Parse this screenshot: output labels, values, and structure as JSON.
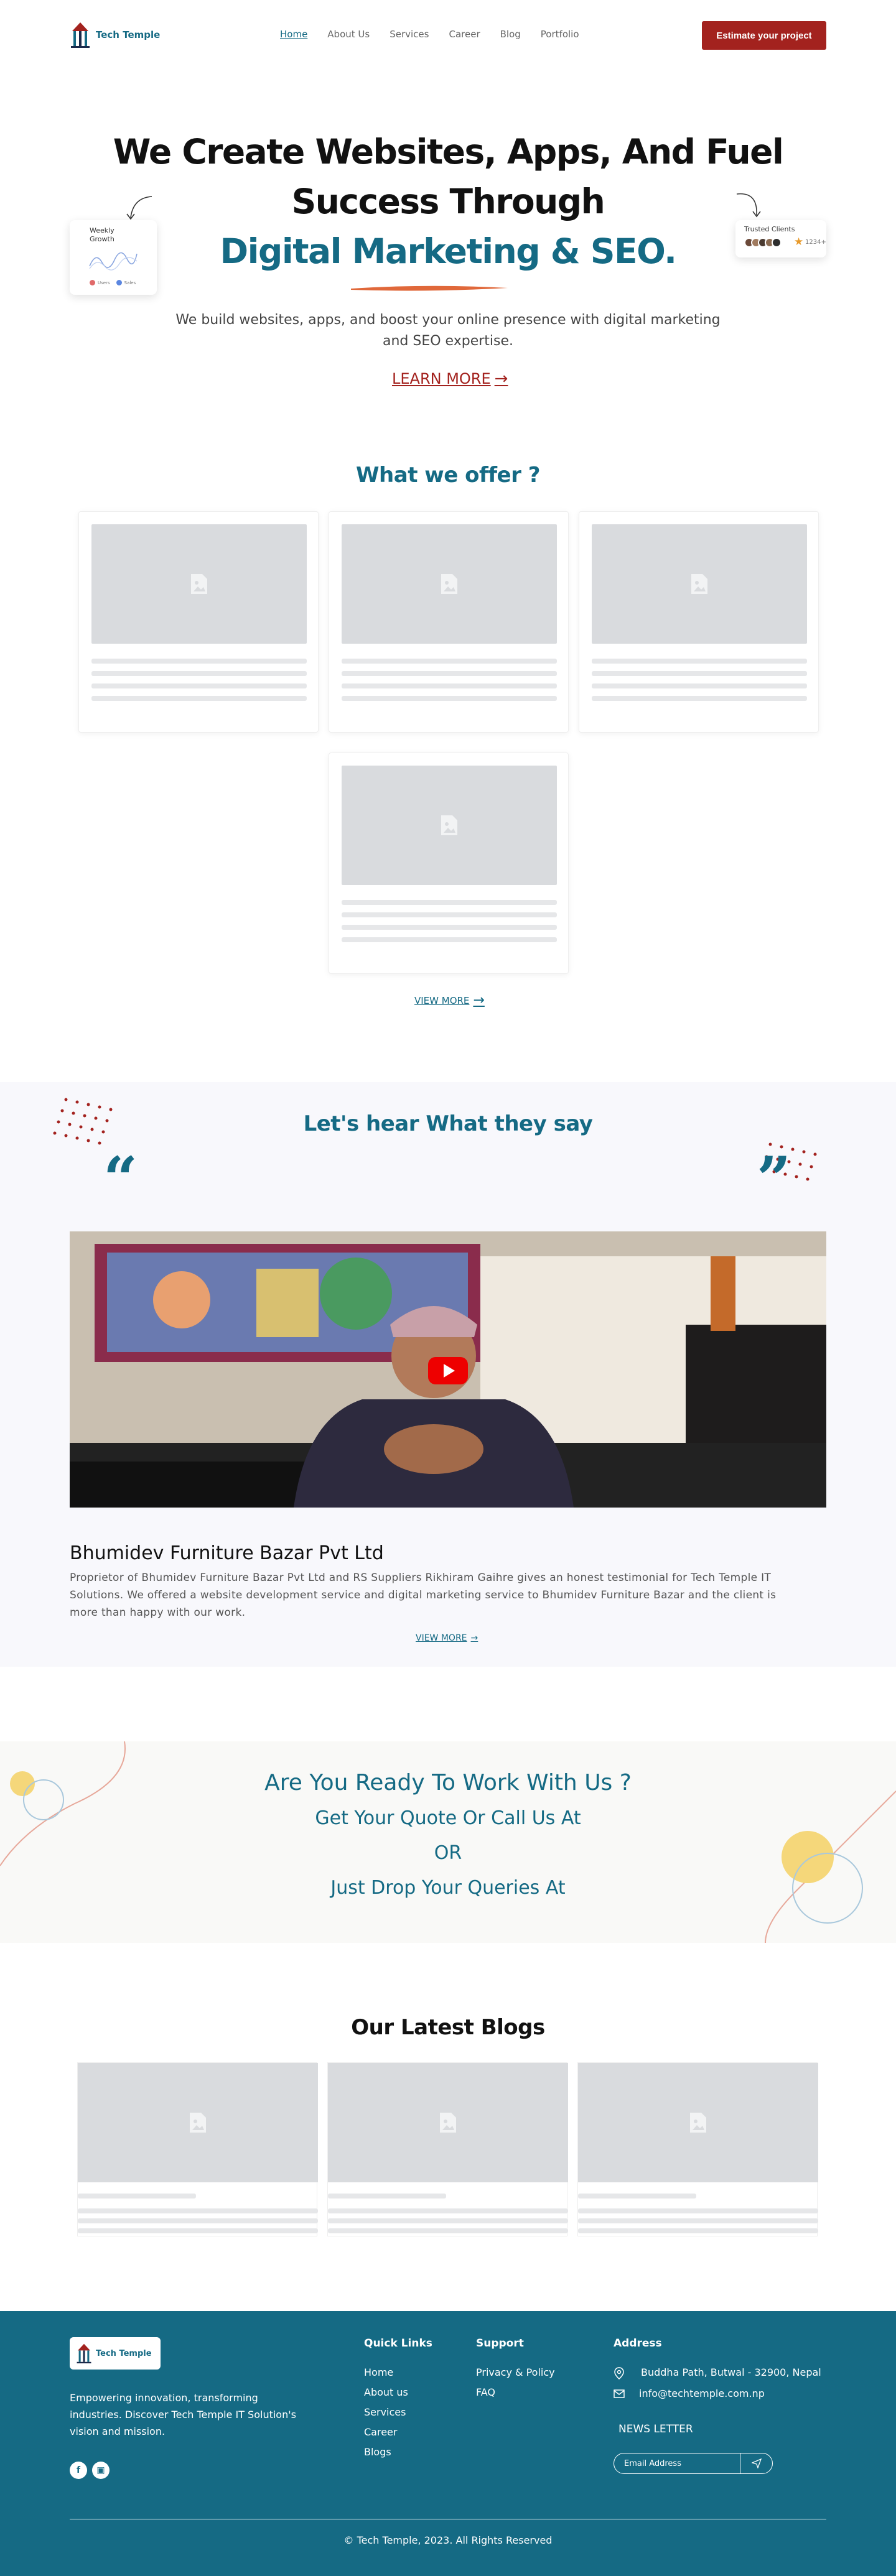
{
  "header": {
    "logo_text": "Tech Temple",
    "nav": [
      "Home",
      "About Us",
      "Services",
      "Career",
      "Blog",
      "Portfolio"
    ],
    "cta_button": "Estimate your project"
  },
  "hero": {
    "line1": "We Create Websites, Apps, And Fuel",
    "line2": "Success Through",
    "line3": "Digital Marketing & SEO.",
    "subtitle": "We build websites, apps, and boost your online presence with digital marketing and SEO expertise.",
    "learn_more": "LEARN MORE",
    "weekly_card": {
      "title_1": "Weekly",
      "title_2": "Growth",
      "legend_a": "Users",
      "legend_b": "Sales"
    },
    "clients_card": {
      "title": "Trusted Clients",
      "count": "1234+"
    }
  },
  "offer": {
    "title": "What we offer ?",
    "view_more": "VIEW MORE"
  },
  "testimonials": {
    "title": "Let's hear What they say",
    "company": "Bhumidev Furniture Bazar Pvt Ltd",
    "description": "Proprietor of Bhumidev Furniture Bazar Pvt Ltd and RS Suppliers Rikhiram Gaihre gives an honest testimonial for Tech Temple IT Solutions. We offered a website development service and digital marketing service to Bhumidev Furniture Bazar and the client is more than happy with our work.",
    "view_more": "VIEW MORE"
  },
  "cta": {
    "line1": "Are You Ready To Work With Us ?",
    "line2": "Get Your Quote Or Call Us At",
    "line3": "OR",
    "line4": "Just Drop Your Queries At"
  },
  "blogs": {
    "title": "Our Latest Blogs"
  },
  "footer": {
    "logo_text": "Tech Temple",
    "about": "Empowering innovation, transforming industries. Discover Tech Temple IT Solution's vision and mission.",
    "quick_links_title": "Quick Links",
    "quick_links": [
      "Home",
      "About us",
      "Services",
      "Career",
      "Blogs"
    ],
    "support_title": "Support",
    "support_links": [
      "Privacy & Policy",
      "FAQ"
    ],
    "address_title": "Address",
    "address": "Buddha Path, Butwal - 32900, Nepal",
    "email": "info@techtemple.com.np",
    "newsletter_title": "NEWS LETTER",
    "newsletter_placeholder": "Email Address",
    "copyright": "© Tech Temple, 2023. All Rights Reserved"
  },
  "colors": {
    "brand": "#156a84",
    "accent": "#a3221e",
    "orange": "#e0683a"
  }
}
